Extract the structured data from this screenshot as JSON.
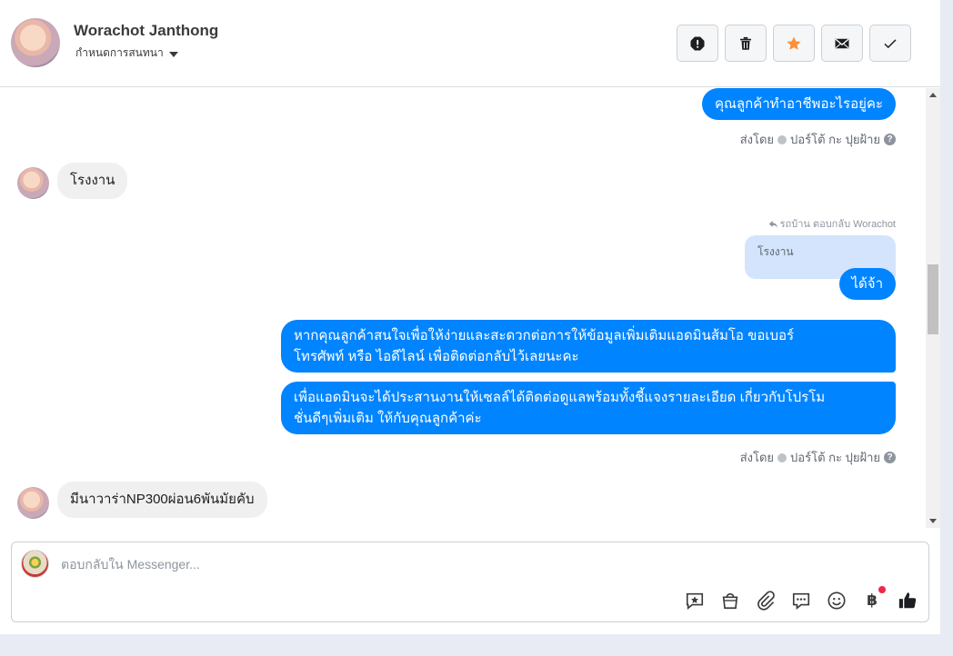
{
  "header": {
    "contact_name": "Worachot Janthong",
    "assign_label": "กำหนดการสนทนา",
    "actions": [
      {
        "name": "mark-spam-button",
        "icon": "alert-octagon-icon"
      },
      {
        "name": "delete-button",
        "icon": "trash-icon"
      },
      {
        "name": "star-button",
        "icon": "star-icon"
      },
      {
        "name": "mark-unread-button",
        "icon": "envelope-icon"
      },
      {
        "name": "mark-done-button",
        "icon": "check-icon"
      }
    ]
  },
  "messages": {
    "m1": {
      "text": "คุณลูกค้าทำอาชีพอะไรอยู่คะ"
    },
    "m1_meta": {
      "prefix": "ส่งโดย",
      "sender": "ปอร์โต้ กะ ปุยฝ้าย"
    },
    "m2": {
      "text": "โรงงาน"
    },
    "reply_note": "รถบ้าน ตอบกลับ Worachot",
    "quoted": "โรงงาน",
    "m3": {
      "text": "ได้จ้า"
    },
    "m4": {
      "line1": "หากคุณลูกค้าสนใจเพื่อให้ง่ายและสะดวกต่อการให้ข้อมูลเพิ่มเติมแอดมินส้มโอ ขอเบอร์",
      "line2": "โทรศัพท์ หรือ ไอดีไลน์ เพื่อติดต่อกลับไว้เลยนะคะ"
    },
    "m5": {
      "line1": "เพื่อแอดมินจะได้ประสานงานให้เซลล์ได้ติดต่อดูแลพร้อมทั้งชี้แจงรายละเอียด เกี่ยวกับโปรโม",
      "line2": "ชั่นดีๆเพิ่มเติม ให้กับคุณลูกค้าค่ะ"
    },
    "m5_meta": {
      "prefix": "ส่งโดย",
      "sender": "ปอร์โต้ กะ ปุยฝ้าย"
    },
    "m6": {
      "text": "มีนาวาร่าNP300ผ่อน6พันมัยคับ"
    }
  },
  "composer": {
    "placeholder": "ตอบกลับใน Messenger...",
    "value": "",
    "tools": [
      "saved-reply-icon",
      "shopping-bag-icon",
      "attachment-icon",
      "chat-bubbles-icon",
      "emoji-icon",
      "baht-icon",
      "thumbs-up-icon"
    ],
    "baht_symbol": "฿"
  },
  "colors": {
    "outgoing": "#0084ff",
    "incoming": "#f0f0f0",
    "quoted": "#d3e4fc",
    "star": "#f7923b",
    "notification_dot": "#f02849"
  }
}
